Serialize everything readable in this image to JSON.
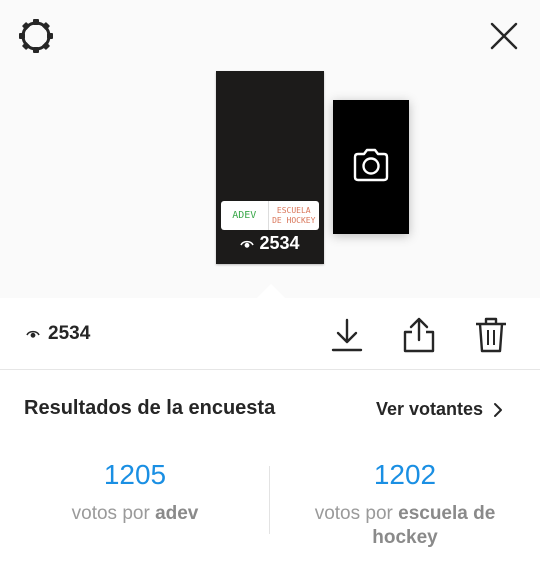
{
  "header": {
    "settings_icon": "gear-icon",
    "close_icon": "close-icon"
  },
  "story": {
    "poll_option_a": "ADEV",
    "poll_option_b": "ESCUELA DE HOCKEY",
    "views": "2534",
    "add_icon": "camera-icon"
  },
  "toolbar": {
    "views": "2534",
    "download_icon": "download-icon",
    "share_icon": "share-icon",
    "delete_icon": "trash-icon"
  },
  "results": {
    "title": "Resultados de la encuesta",
    "see_voters": "Ver votantes",
    "options": [
      {
        "count": "1205",
        "prefix": "votos por",
        "name": "adev"
      },
      {
        "count": "1202",
        "prefix": "votos por",
        "name": "escuela de hockey"
      }
    ]
  },
  "colors": {
    "accent": "#1a8fe3",
    "poll_a": "#3aa84a",
    "poll_b": "#d9765a"
  }
}
